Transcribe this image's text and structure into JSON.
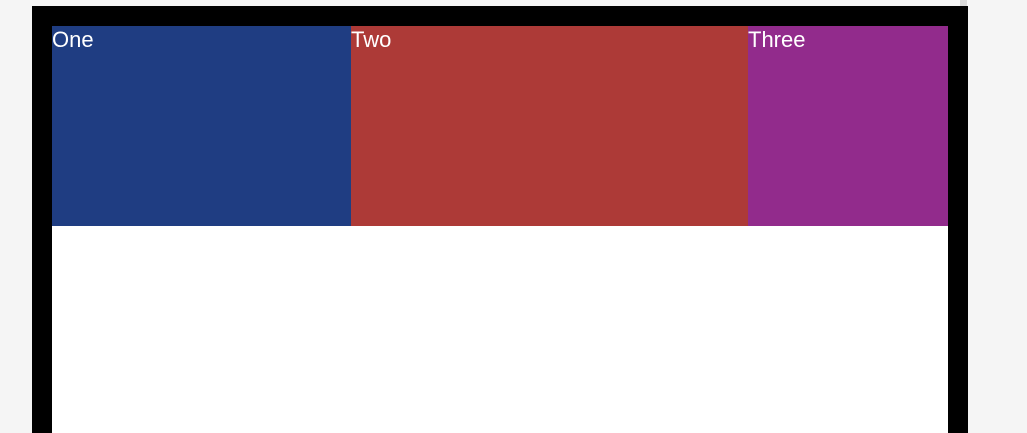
{
  "boxes": [
    {
      "label": "One",
      "color": "#1f3d82"
    },
    {
      "label": "Two",
      "color": "#ad3a37"
    },
    {
      "label": "Three",
      "color": "#922b8c"
    }
  ]
}
